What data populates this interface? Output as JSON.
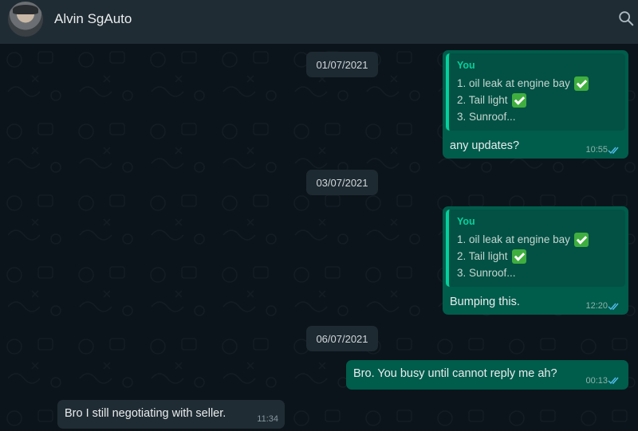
{
  "header": {
    "contact_name": "Alvin SgAuto",
    "avatar": "avatar-photo",
    "search_icon": "search-icon"
  },
  "colors": {
    "header_bg": "#202c33",
    "chat_bg": "#0b141a",
    "outgoing_bubble": "#005c4b",
    "incoming_bubble": "#202c33",
    "quote_accent": "#06cf9c",
    "read_ticks": "#53bdeb"
  },
  "messages": {
    "date1": "01/07/2021",
    "date2": "03/07/2021",
    "date3": "06/07/2021",
    "m1": {
      "quote_sender": "You",
      "quote_line1": "1. oil leak at engine bay",
      "quote_line2": "2. Tail light",
      "quote_line3": "3. Sunroof...",
      "text": "any updates?",
      "time": "10:55"
    },
    "m2": {
      "quote_sender": "You",
      "quote_line1": "1. oil leak at engine bay",
      "quote_line2": "2. Tail light",
      "quote_line3": "3. Sunroof...",
      "text": "Bumping this.",
      "time": "12:20"
    },
    "m3": {
      "text": "Bro. You busy until cannot reply me ah?",
      "time": "00:13"
    },
    "m4": {
      "text": "Bro I still negotiating with seller.",
      "time": "11:34"
    }
  }
}
